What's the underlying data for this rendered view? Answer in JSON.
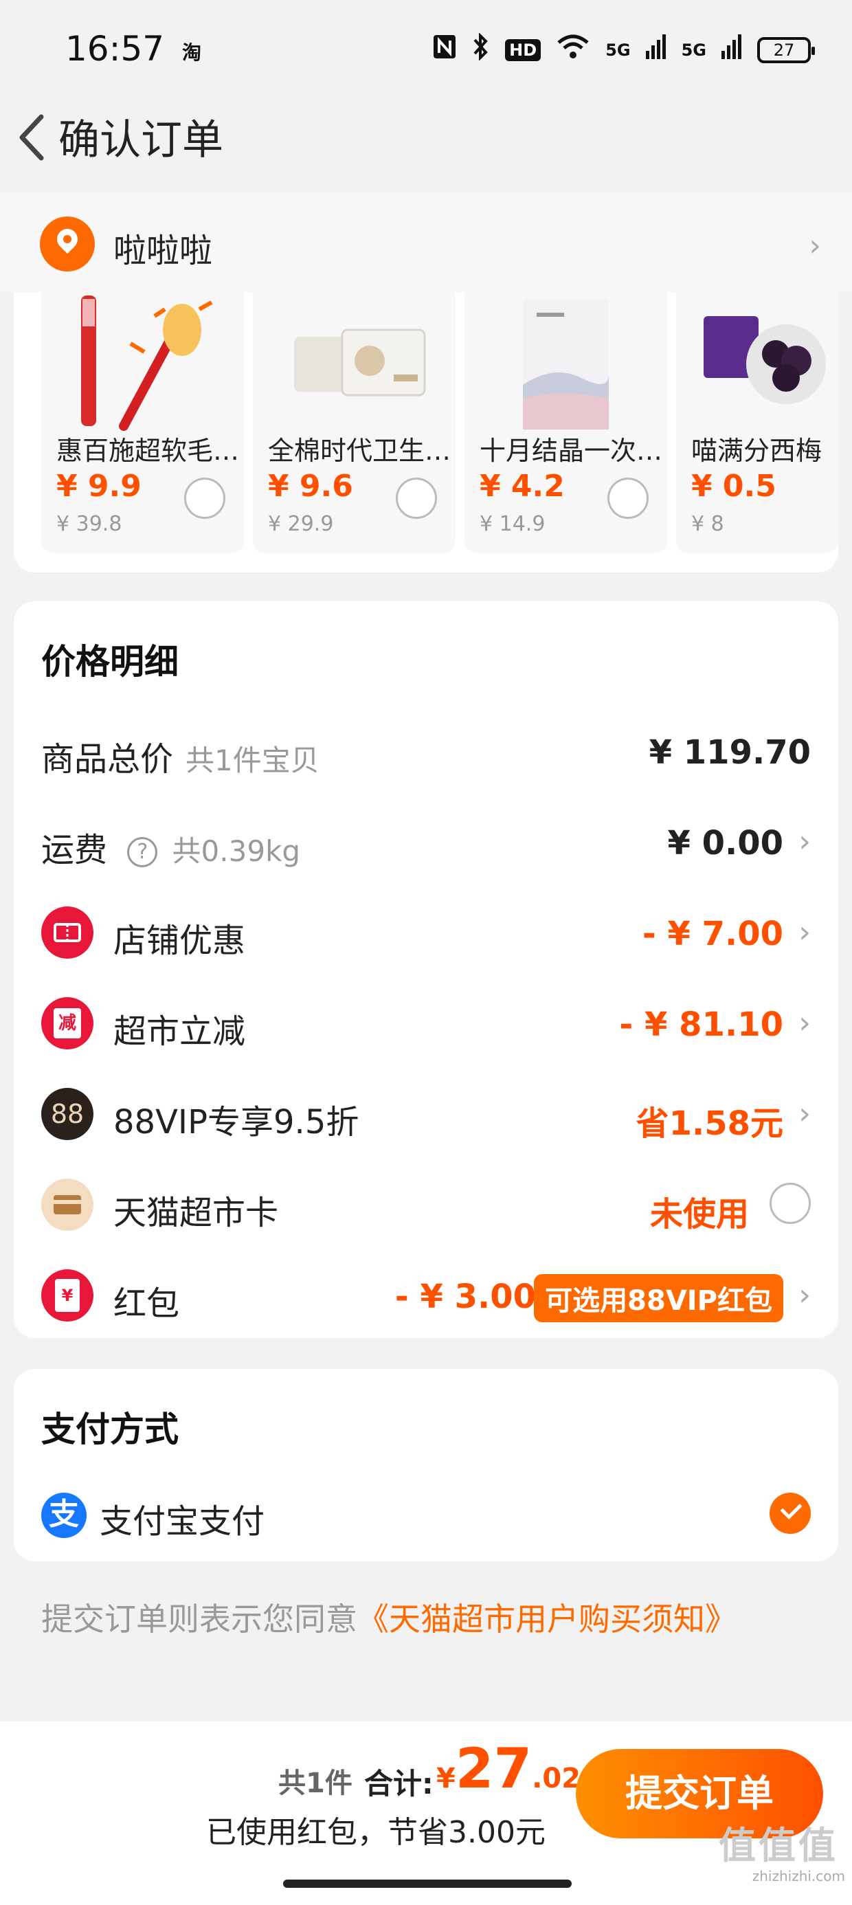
{
  "status_bar": {
    "time": "16:57",
    "app_glyph": "淘",
    "icons": [
      "nfc-icon",
      "bluetooth-icon",
      "hd-icon",
      "wifi-icon",
      "signal-5g-icon",
      "signal-5g-icon",
      "battery-icon"
    ],
    "hd_label": "HD",
    "network_label_1": "5G",
    "network_label_2": "5G",
    "battery_level": "27"
  },
  "nav": {
    "title": "确认订单"
  },
  "address": {
    "name": "啦啦啦"
  },
  "products": [
    {
      "name": "惠百施超软毛…",
      "price": "¥ 9.9",
      "original_price": "¥ 39.8"
    },
    {
      "name": "全棉时代卫生…",
      "price": "¥ 9.6",
      "original_price": "¥ 29.9"
    },
    {
      "name": "十月结晶一次…",
      "price": "¥ 4.2",
      "original_price": "¥ 14.9"
    },
    {
      "name": "喵满分西梅",
      "price": "¥ 0.5",
      "original_price": "¥ 8"
    }
  ],
  "price_detail": {
    "title": "价格明细",
    "rows": [
      {
        "label": "商品总价",
        "sub": "共1件宝贝",
        "value": "¥ 119.70"
      },
      {
        "label": "运费",
        "sub": "共0.39kg",
        "value": "¥ 0.00"
      },
      {
        "label": "店铺优惠",
        "value": "- ¥ 7.00"
      },
      {
        "label": "超市立减",
        "value": "- ¥ 81.10",
        "icon_text": "减"
      },
      {
        "label": "88VIP专享9.5折",
        "value": "省1.58元",
        "icon_text": "88"
      },
      {
        "label": "天猫超市卡",
        "value": "未使用"
      },
      {
        "label": "红包",
        "value": "- ¥ 3.00",
        "tag": "可选用88VIP红包",
        "icon_text": "¥"
      }
    ]
  },
  "payment": {
    "title": "支付方式",
    "method": "支付宝支付",
    "icon_text": "支"
  },
  "agreement": {
    "prefix": "提交订单则表示您同意",
    "link": "《天猫超市用户购买须知》"
  },
  "footer": {
    "count": "共1件",
    "total_label": "合计:",
    "total_symbol": "¥",
    "total_int": "27",
    "total_dec": ".02",
    "saved": "已使用红包，节省3.00元",
    "submit": "提交订单"
  },
  "watermark": {
    "glyphs": "值值值",
    "site": "zhizhizhi.com"
  },
  "colors": {
    "accent": "#ff5000",
    "accent_light": "#ff6a00",
    "alipay": "#1677ff"
  }
}
